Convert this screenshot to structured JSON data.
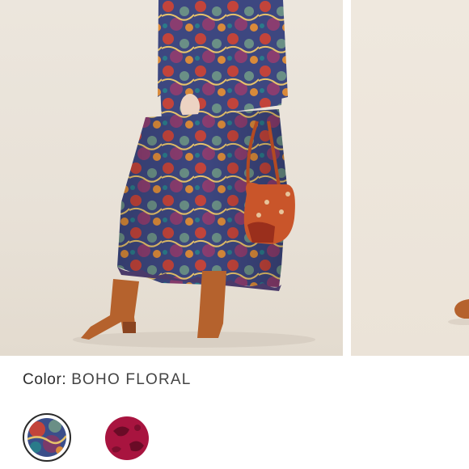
{
  "product": {
    "color_label": "Color:",
    "color_value": "BOHO FLORAL"
  },
  "swatches": [
    {
      "icon": "boho-floral-swatch",
      "selected": true,
      "colors": [
        "#3b4e8a",
        "#c2443b",
        "#6a8f86",
        "#7a3a6a"
      ]
    },
    {
      "icon": "berry-paisley-swatch",
      "selected": false,
      "colors": [
        "#a8143f",
        "#6a0b26"
      ]
    }
  ]
}
